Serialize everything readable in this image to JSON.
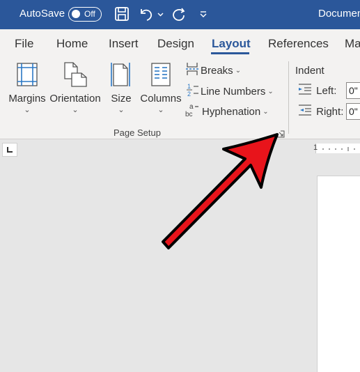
{
  "titlebar": {
    "autosave_label": "AutoSave",
    "autosave_state": "Off",
    "document_title": "Documen",
    "icons": [
      "save-icon",
      "undo-icon",
      "redo-icon",
      "customize-toolbar-icon"
    ],
    "background_color": "#2b579a"
  },
  "tabs": [
    {
      "label": "File"
    },
    {
      "label": "Home"
    },
    {
      "label": "Insert"
    },
    {
      "label": "Design"
    },
    {
      "label": "Layout",
      "active": true
    },
    {
      "label": "References"
    },
    {
      "label": "Ma"
    }
  ],
  "page_setup": {
    "group_label": "Page Setup",
    "buttons": [
      {
        "label": "Margins",
        "icon": "margins-icon"
      },
      {
        "label": "Orientation",
        "icon": "orientation-icon"
      },
      {
        "label": "Size",
        "icon": "size-icon"
      },
      {
        "label": "Columns",
        "icon": "columns-icon"
      }
    ],
    "small_buttons": [
      {
        "label": "Breaks",
        "icon": "breaks-icon"
      },
      {
        "label": "Line Numbers",
        "icon": "line-numbers-icon"
      },
      {
        "label": "Hyphenation",
        "icon": "hyphenation-icon"
      }
    ]
  },
  "indent": {
    "title": "Indent",
    "left_label": "Left:",
    "left_value": "0\"",
    "right_label": "Right:",
    "right_value": "0\""
  },
  "ruler": {
    "tick_label": "1"
  },
  "annotation": {
    "arrow_color": "#e8141b"
  }
}
